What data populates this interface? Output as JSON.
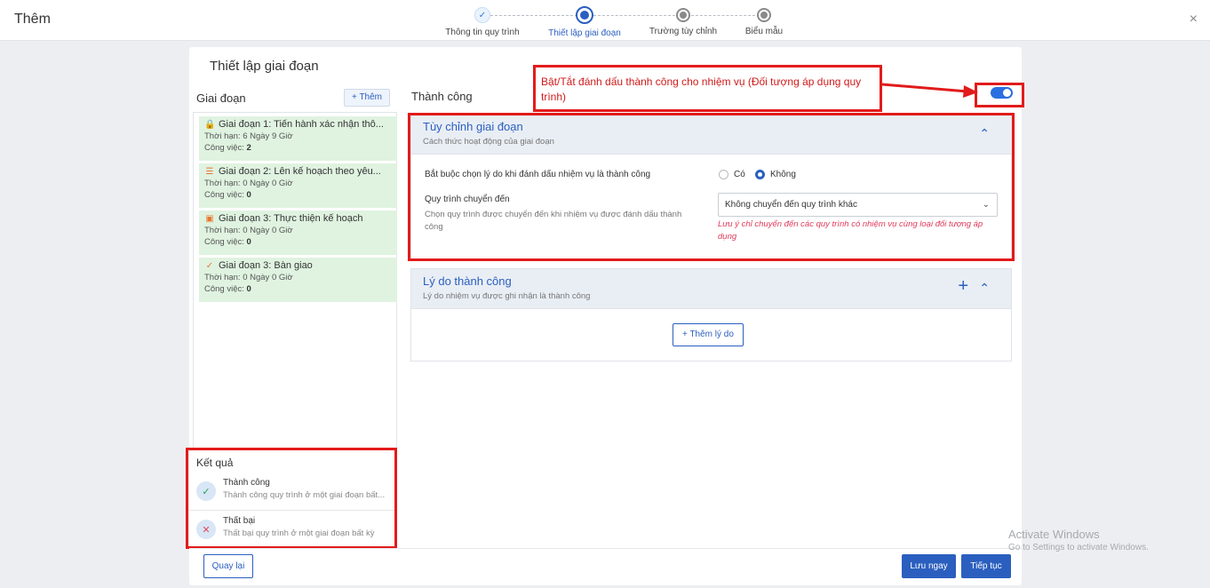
{
  "window": {
    "title": "Thêm",
    "close_icon": "×"
  },
  "stepper": {
    "steps": [
      {
        "label": "Thông tin quy trình",
        "state": "done"
      },
      {
        "label": "Thiết lập giai đoạn",
        "state": "active"
      },
      {
        "label": "Trường tùy chỉnh",
        "state": "todo"
      },
      {
        "label": "Biểu mẫu",
        "state": "todo"
      }
    ]
  },
  "card": {
    "title": "Thiết lập giai đoạn"
  },
  "stages_panel": {
    "header": "Giai đoạn",
    "add_label": "+ Thêm",
    "stages": [
      {
        "title": "Giai đoạn 1: Tiến hành xác nhận thô...",
        "icon": "lock-icon",
        "duration_label": "Thời hạn:",
        "duration": "6 Ngày 9 Giờ",
        "tasks_label": "Công việc:",
        "tasks": "2"
      },
      {
        "title": "Giai đoạn 2: Lên kế hoạch theo yêu...",
        "icon": "list-icon",
        "duration_label": "Thời hạn:",
        "duration": "0 Ngày 0 Giờ",
        "tasks_label": "Công việc:",
        "tasks": "0"
      },
      {
        "title": "Giai đoạn 3: Thực thiện kế hoạch",
        "icon": "calendar-icon",
        "duration_label": "Thời hạn:",
        "duration": "0 Ngày 0 Giờ",
        "tasks_label": "Công việc:",
        "tasks": "0"
      },
      {
        "title": "Giai đoạn 3: Bàn giao",
        "icon": "check-icon",
        "duration_label": "Thời hạn:",
        "duration": "0 Ngày 0 Giờ",
        "tasks_label": "Công việc:",
        "tasks": "0"
      }
    ]
  },
  "results": {
    "header": "Kết quả",
    "items": [
      {
        "title": "Thành công",
        "desc": "Thành công quy trình ở một giai đoạn bất..."
      },
      {
        "title": "Thất bại",
        "desc": "Thất bại quy trình ở một giai đoạn bất kỳ"
      }
    ]
  },
  "detail": {
    "header": "Thành công",
    "annotation": "Bật/Tắt đánh dấu thành công cho nhiệm vụ (Đối tượng áp dụng quy trình)",
    "toggle_on": true,
    "customize": {
      "title": "Tùy chỉnh giai đoạn",
      "subtitle": "Cách thức hoạt động của giai đoạn",
      "require_reason_label": "Bắt buộc chọn lý do khi đánh dấu nhiệm vụ là thành công",
      "option_yes": "Có",
      "option_no": "Không",
      "selected": "Không",
      "transfer_label": "Quy trình chuyển đến",
      "transfer_desc": "Chọn quy trình được chuyển đến khi nhiệm vụ được đánh dấu thành công",
      "transfer_value": "Không chuyển đến quy trình khác",
      "transfer_note": "Lưu ý chỉ chuyển đến các quy trình có nhiệm vụ cùng loại đối tượng áp dụng"
    },
    "reasons": {
      "title": "Lý do thành công",
      "subtitle": "Lý do nhiệm vụ được ghi nhận là thành công",
      "add_label": "Thêm lý do"
    }
  },
  "footer": {
    "back": "Quay lại",
    "save": "Lưu ngay",
    "next": "Tiếp tục"
  },
  "watermark": {
    "line1": "Activate Windows",
    "line2": "Go to Settings to activate Windows."
  },
  "colors": {
    "primary": "#2b5fbf",
    "highlight": "#e21b1b",
    "stage_bg": "#dff3e0"
  }
}
